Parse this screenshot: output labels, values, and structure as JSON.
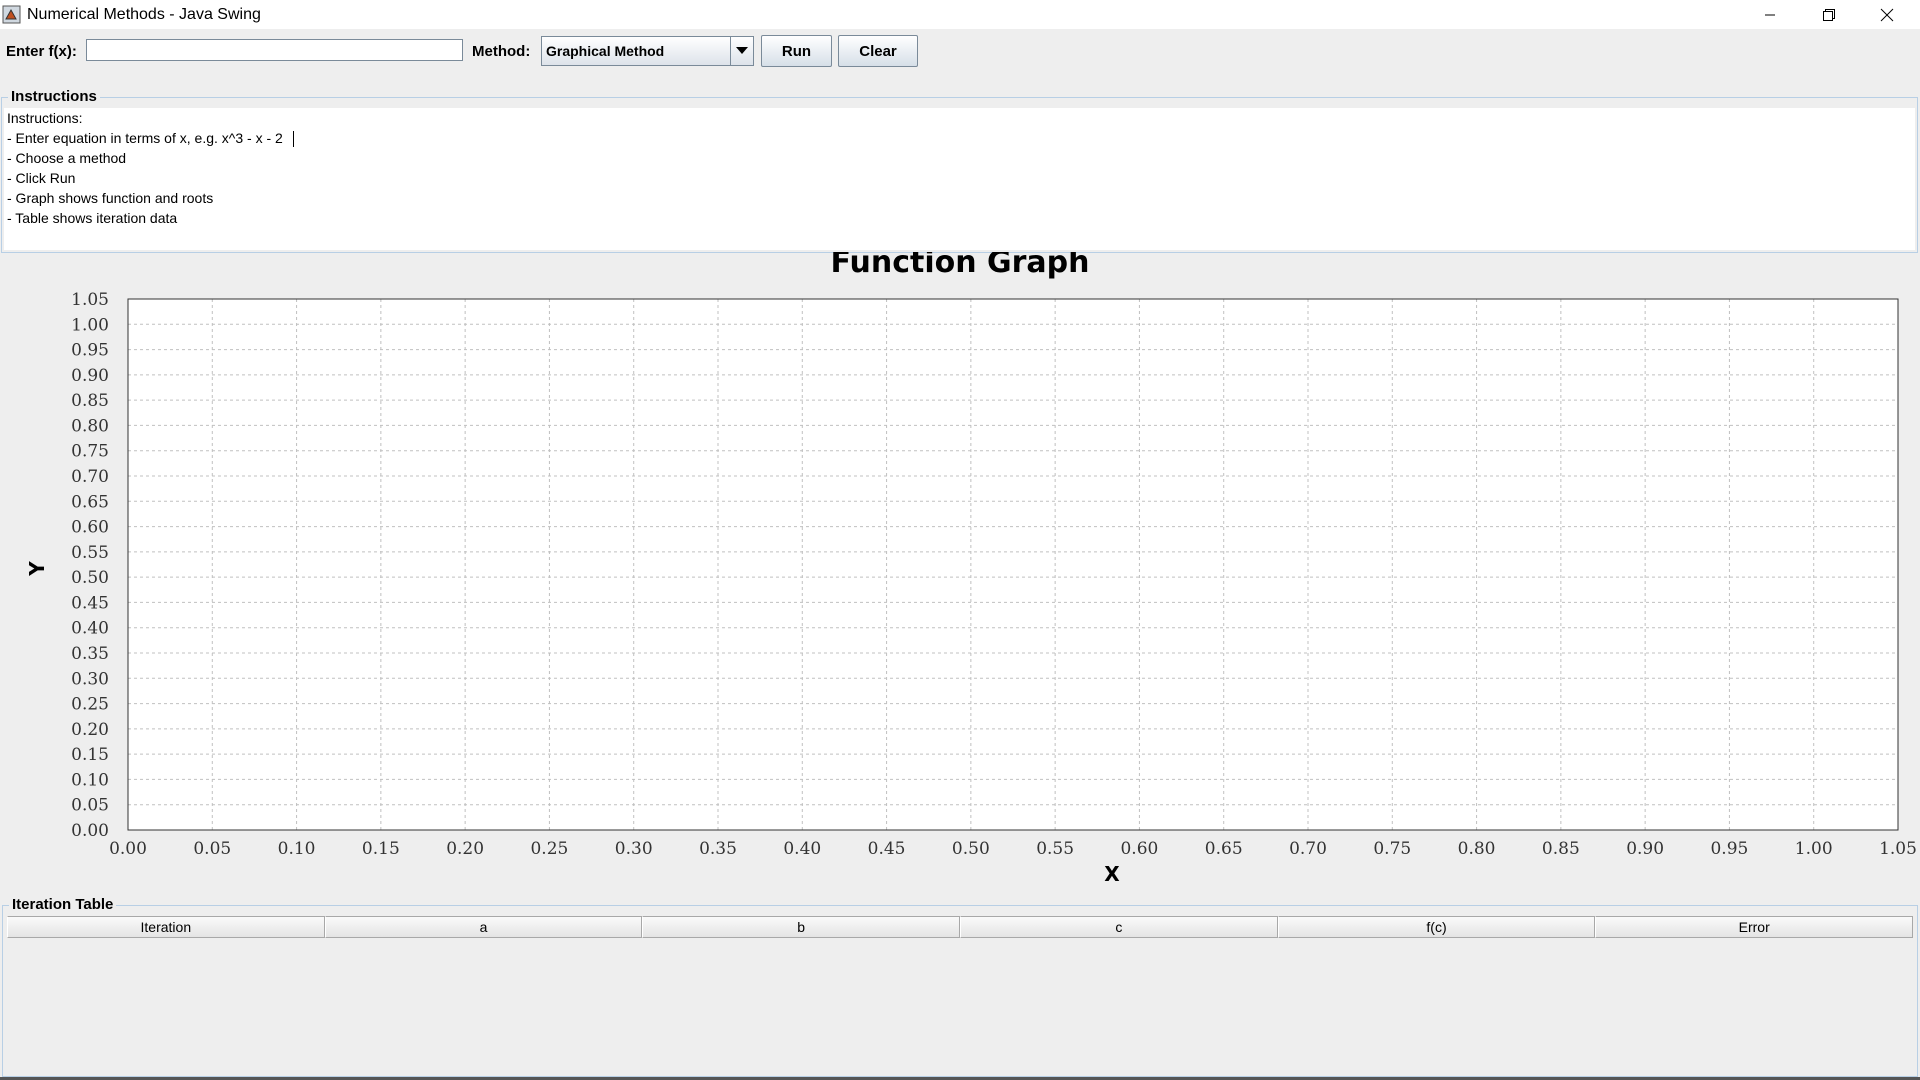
{
  "window": {
    "title": "Numerical Methods - Java Swing",
    "controls": [
      "minimize-icon",
      "restore-icon",
      "close-icon"
    ]
  },
  "toolbar": {
    "fx_label": "Enter f(x):",
    "fx_value": "",
    "method_label": "Method:",
    "method_selected": "Graphical Method",
    "run_label": "Run",
    "clear_label": "Clear"
  },
  "instructions": {
    "title": "Instructions",
    "lines": [
      "Instructions:",
      "- Enter equation in terms of x, e.g. x^3 - x - 2",
      "- Choose a method",
      "- Click Run",
      "- Graph shows function and roots",
      "- Table shows iteration data"
    ]
  },
  "chart_data": {
    "type": "line",
    "title": "Function Graph",
    "xlabel": "X",
    "ylabel": "Y",
    "xlim": [
      0,
      1.05
    ],
    "ylim": [
      0,
      1.05
    ],
    "x_ticks": [
      "0.00",
      "0.05",
      "0.10",
      "0.15",
      "0.20",
      "0.25",
      "0.30",
      "0.35",
      "0.40",
      "0.45",
      "0.50",
      "0.55",
      "0.60",
      "0.65",
      "0.70",
      "0.75",
      "0.80",
      "0.85",
      "0.90",
      "0.95",
      "1.00",
      "1.05"
    ],
    "y_ticks": [
      "0.00",
      "0.05",
      "0.10",
      "0.15",
      "0.20",
      "0.25",
      "0.30",
      "0.35",
      "0.40",
      "0.45",
      "0.50",
      "0.55",
      "0.60",
      "0.65",
      "0.70",
      "0.75",
      "0.80",
      "0.85",
      "0.90",
      "0.95",
      "1.00",
      "1.05"
    ],
    "grid": true,
    "series": []
  },
  "iteration_table": {
    "title": "Iteration Table",
    "columns": [
      "Iteration",
      "a",
      "b",
      "c",
      "f(c)",
      "Error"
    ],
    "rows": []
  },
  "colors": {
    "window_bg": "#eeeeee",
    "panel_border": "#b8cfe5",
    "grid": "#c0c0c0"
  }
}
